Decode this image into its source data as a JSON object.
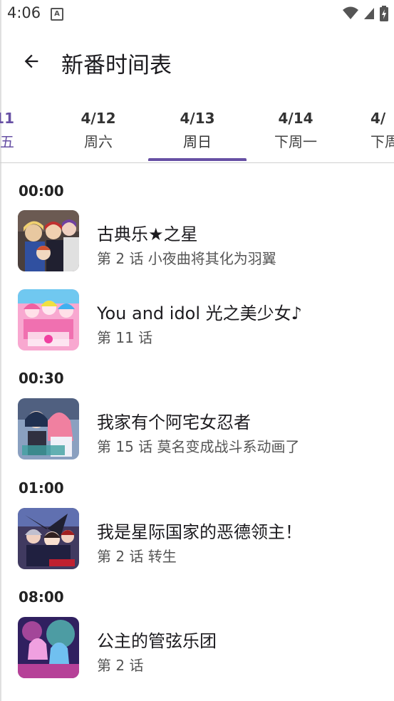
{
  "status_bar": {
    "time": "4:06",
    "notification_glyph": "A"
  },
  "app_bar": {
    "title": "新番时间表"
  },
  "tabs": [
    {
      "date": "11",
      "day": "五"
    },
    {
      "date": "4/12",
      "day": "周六"
    },
    {
      "date": "4/13",
      "day": "周日"
    },
    {
      "date": "4/14",
      "day": "下周一"
    },
    {
      "date": "4/",
      "day": "下周"
    }
  ],
  "schedule": [
    {
      "time": "00:00"
    },
    {
      "time": "00:30"
    },
    {
      "time": "01:00"
    },
    {
      "time": "08:00"
    }
  ],
  "items": [
    {
      "title": "古典乐★之星",
      "episode": "第 2 话  小夜曲将其化为羽翼"
    },
    {
      "title": "You and idol 光之美少女♪",
      "episode": "第 11 话"
    },
    {
      "title": "我家有个阿宅女忍者",
      "episode": "第 15 话  莫名变成战斗系动画了"
    },
    {
      "title": "我是星际国家的恶德领主！",
      "episode": "第 2 话  转生"
    },
    {
      "title": "公主的管弦乐团",
      "episode": "第 2 话"
    }
  ],
  "colors": {
    "accent": "#6750a4",
    "divider": "#d0d0d0"
  }
}
